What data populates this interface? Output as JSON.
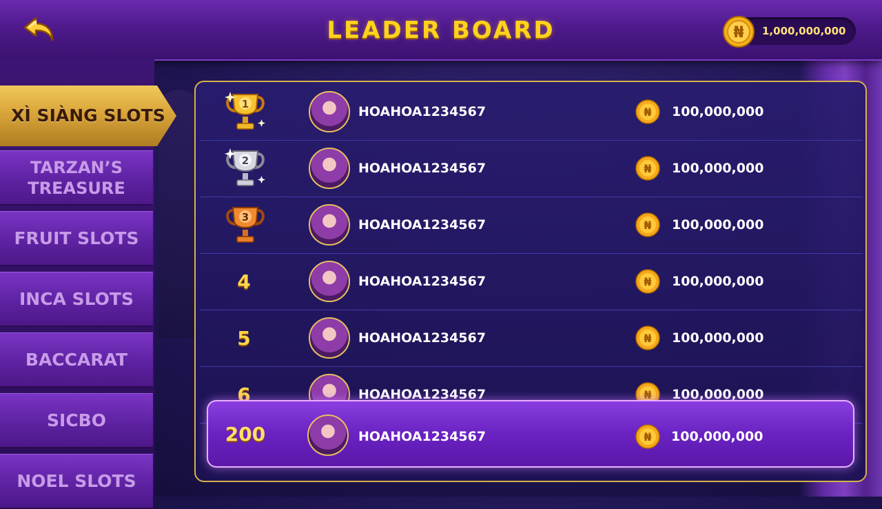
{
  "header": {
    "title": "LEADER BOARD",
    "back_icon": "back-arrow-icon",
    "balance": "1,000,000,000",
    "currency_symbol": "₦"
  },
  "sidebar": {
    "items": [
      {
        "label": "XÌ SIÀNG SLOTS",
        "active": true
      },
      {
        "label": "TARZAN’S TREASURE",
        "active": false
      },
      {
        "label": "FRUIT SLOTS",
        "active": false
      },
      {
        "label": "INCA SLOTS",
        "active": false
      },
      {
        "label": "BACCARAT",
        "active": false
      },
      {
        "label": "SICBO",
        "active": false
      },
      {
        "label": "NOEL SLOTS",
        "active": false
      }
    ]
  },
  "leaderboard": {
    "rows": [
      {
        "rank": "1",
        "trophy": "gold",
        "name": "HOAHOA1234567",
        "amount": "100,000,000"
      },
      {
        "rank": "2",
        "trophy": "silver",
        "name": "HOAHOA1234567",
        "amount": "100,000,000"
      },
      {
        "rank": "3",
        "trophy": "bronze",
        "name": "HOAHOA1234567",
        "amount": "100,000,000"
      },
      {
        "rank": "4",
        "name": "HOAHOA1234567",
        "amount": "100,000,000"
      },
      {
        "rank": "5",
        "name": "HOAHOA1234567",
        "amount": "100,000,000"
      },
      {
        "rank": "6",
        "name": "HOAHOA1234567",
        "amount": "100,000,000"
      }
    ],
    "own": {
      "rank": "200",
      "name": "HOAHOA1234567",
      "amount": "100,000,000"
    }
  },
  "colors": {
    "gold": "#ffd21e",
    "panel_border": "#d8b34a",
    "purple": "#6a22c2"
  }
}
